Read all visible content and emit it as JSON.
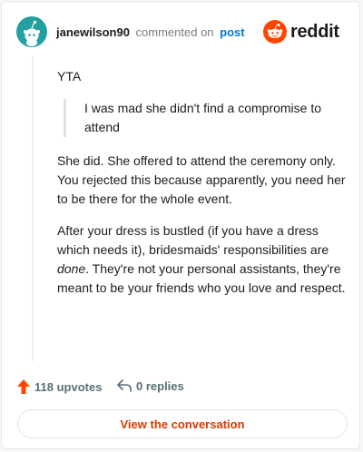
{
  "header": {
    "username": "janewilson90",
    "action_text": "commented on",
    "post_link": "post",
    "brand_name": "reddit"
  },
  "comment": {
    "intro": "YTA",
    "quote": "I was mad she didn't find a compromise to attend",
    "paragraph_1": "She did. She offered to attend the ceremony only. You rejected this because apparently, you need her to be there for the whole event.",
    "paragraph_2_before": "After your dress is bustled (if you have a dress which needs it), bridesmaids' responsibilities are ",
    "paragraph_2_emphasis": "done",
    "paragraph_2_after": ". They're not your personal assistants, they're meant to be your friends who you love and respect."
  },
  "footer": {
    "upvotes_label": "118 upvotes",
    "replies_label": "0 replies"
  },
  "cta": {
    "label": "View the conversation"
  },
  "colors": {
    "accent": "#d93a00",
    "reddit_orange": "#ff4500",
    "avatar_teal": "#24a0a0",
    "link_blue": "#0079d3"
  },
  "icons": {
    "avatar": "snoo-avatar-icon",
    "brand": "reddit-logo-icon",
    "upvote": "upvote-arrow-icon",
    "reply": "reply-arrow-icon"
  }
}
